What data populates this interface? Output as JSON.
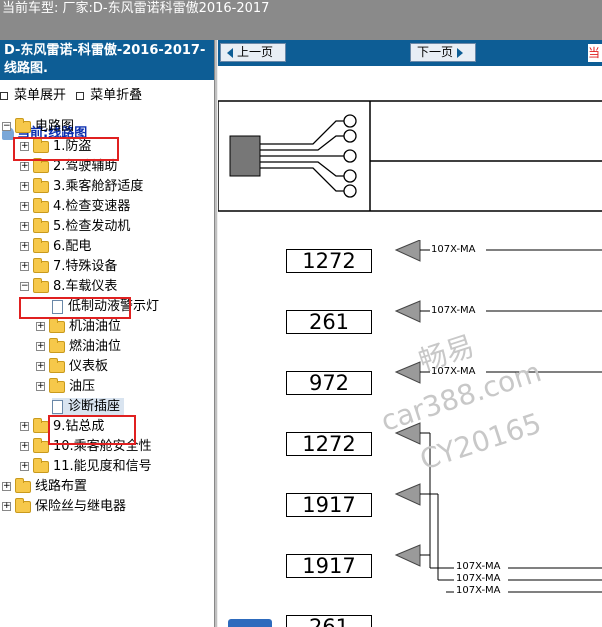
{
  "topbar": {
    "text": "当前车型:  厂家:D-东风雷诺科雷傲2016-2017"
  },
  "left": {
    "title": "D-东风雷诺-科雷傲-2016-2017- 线路图.",
    "expand_label": "菜单展开",
    "collapse_label": "菜单折叠",
    "current_label": "当前:线路图"
  },
  "tree": {
    "root": "电路图",
    "items": [
      "1.防盗",
      "2.驾驶辅助",
      "3.乘客舱舒适度",
      "4.检查变速器",
      "5.检查发动机",
      "6.配电",
      "7.特殊设备",
      "8.车载仪表"
    ],
    "sub_items": [
      "低制动液警示灯",
      "机油油位",
      "燃油油位",
      "仪表板",
      "油压",
      "诊断插座"
    ],
    "after_items": [
      "9.钻总成",
      "10.乘客舱安全性",
      "11.能见度和信号"
    ],
    "top_level": [
      "线路布置",
      "保险丝与继电器"
    ]
  },
  "viewer": {
    "prev_label": "上一页",
    "next_label": "下一页",
    "edge_label": "当",
    "connectors": [
      "1272",
      "261",
      "972",
      "1272",
      "1917",
      "1917",
      "261"
    ],
    "signal": "107X-MA"
  },
  "watermark": {
    "line1": "畅易",
    "line2": "car388.com",
    "line3": "CY20165"
  },
  "colors": {
    "accent": "#0d5d95",
    "topbar": "#8a8a8a",
    "highlight": "#e02020"
  }
}
